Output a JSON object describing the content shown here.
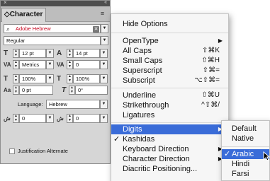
{
  "panel": {
    "close": "×",
    "collapse": "«",
    "title": "◇Character",
    "menu_icon": "≡",
    "font_family": "Adobe Hebrew",
    "font_style": "Regular",
    "font_size": "12 pt",
    "leading": "14 pt",
    "kerning": "Metrics",
    "tracking": "0",
    "vertical_scale": "100%",
    "horizontal_scale": "100%",
    "baseline_shift": "0 pt",
    "skew": "0°",
    "language_label": "Language:",
    "language": "Hebrew",
    "diacritic_left": "0",
    "diacritic_right": "0",
    "justification_alternate": "Justification Alternate"
  },
  "menu": {
    "items": [
      {
        "label": "Hide Options",
        "shortcut": "",
        "arrow": ""
      },
      {
        "label": "OpenType",
        "shortcut": "",
        "arrow": "▶"
      },
      {
        "label": "All Caps",
        "shortcut": "⇧⌘K",
        "arrow": ""
      },
      {
        "label": "Small Caps",
        "shortcut": "⇧⌘H",
        "arrow": ""
      },
      {
        "label": "Superscript",
        "shortcut": "⇧⌘=",
        "arrow": ""
      },
      {
        "label": "Subscript",
        "shortcut": "⌥⇧⌘=",
        "arrow": ""
      },
      {
        "label": "Underline",
        "shortcut": "⇧⌘U",
        "arrow": ""
      },
      {
        "label": "Strikethrough",
        "shortcut": "^⇧⌘/",
        "arrow": ""
      },
      {
        "label": "Ligatures",
        "shortcut": "",
        "arrow": ""
      },
      {
        "label": "Digits",
        "shortcut": "",
        "arrow": "▶"
      },
      {
        "label": "Kashidas",
        "shortcut": "",
        "arrow": "",
        "check": "✓"
      },
      {
        "label": "Keyboard Direction",
        "shortcut": "",
        "arrow": "▶"
      },
      {
        "label": "Character Direction",
        "shortcut": "",
        "arrow": "▶"
      },
      {
        "label": "Diacritic Positioning...",
        "shortcut": "",
        "arrow": ""
      }
    ]
  },
  "submenu": {
    "items": [
      "Default",
      "Native",
      "Arabic",
      "Hindi",
      "Farsi"
    ],
    "checked": "✓"
  },
  "colors": {
    "highlight": "#3a6cd8",
    "panel_bg": "#d6d6d6",
    "menu_bg": "#f6f6f6"
  }
}
